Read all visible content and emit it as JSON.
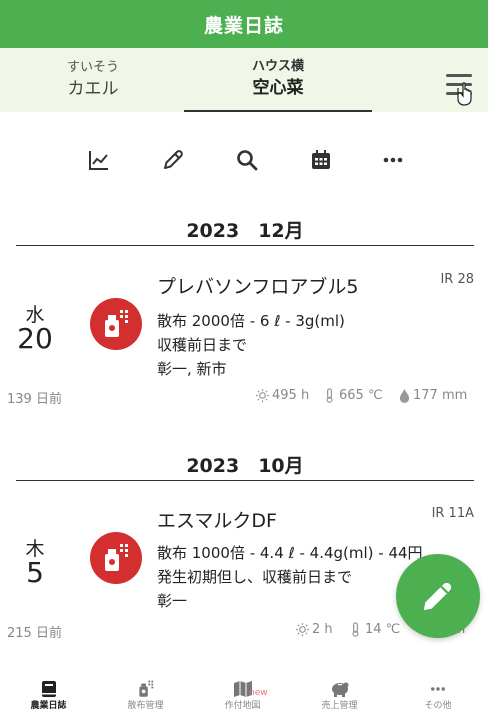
{
  "app": {
    "title": "農業日誌"
  },
  "tabs": [
    {
      "sub": "すいそう",
      "main": "カエル"
    },
    {
      "sub": "ハウス横",
      "main": "空心菜"
    }
  ],
  "toolbar": [
    "chart-icon",
    "pencil-icon",
    "search-icon",
    "calendar-icon",
    "more-icon"
  ],
  "groups": [
    {
      "month": "2023　12月",
      "entry": {
        "dow": "水",
        "day": "20",
        "title": "プレバソンフロアブル5",
        "ir": "IR 28",
        "line1": "散布 2000倍 - 6 ℓ  - 3g(ml)",
        "line2": "収穫前日まで",
        "line3": "彰一, 新市",
        "ago": "139 日前",
        "stat_hours": "495 h",
        "stat_temp": "665 ℃",
        "stat_rain": "177 mm"
      }
    },
    {
      "month": "2023　10月",
      "entry": {
        "dow": "木",
        "day": "5",
        "title": "エスマルクDF",
        "ir": "IR 11A",
        "line1": "散布 1000倍 - 4.4 ℓ  - 4.4g(ml) - 44円",
        "line2": "発生初期但し、収穫前日まで",
        "line3": "彰一",
        "ago": "215 日前",
        "stat_hours": "2 h",
        "stat_temp": "14 ℃",
        "stat_rain": "mm"
      }
    }
  ],
  "nav": [
    {
      "label": "農業日誌",
      "active": true
    },
    {
      "label": "散布管理"
    },
    {
      "label": "作付地図",
      "badge": "new"
    },
    {
      "label": "売上管理"
    },
    {
      "label": "その他"
    }
  ],
  "colors": {
    "primary": "#4caf50",
    "tab_bg": "#f0f7e8",
    "badge_red": "#d32f2f"
  }
}
